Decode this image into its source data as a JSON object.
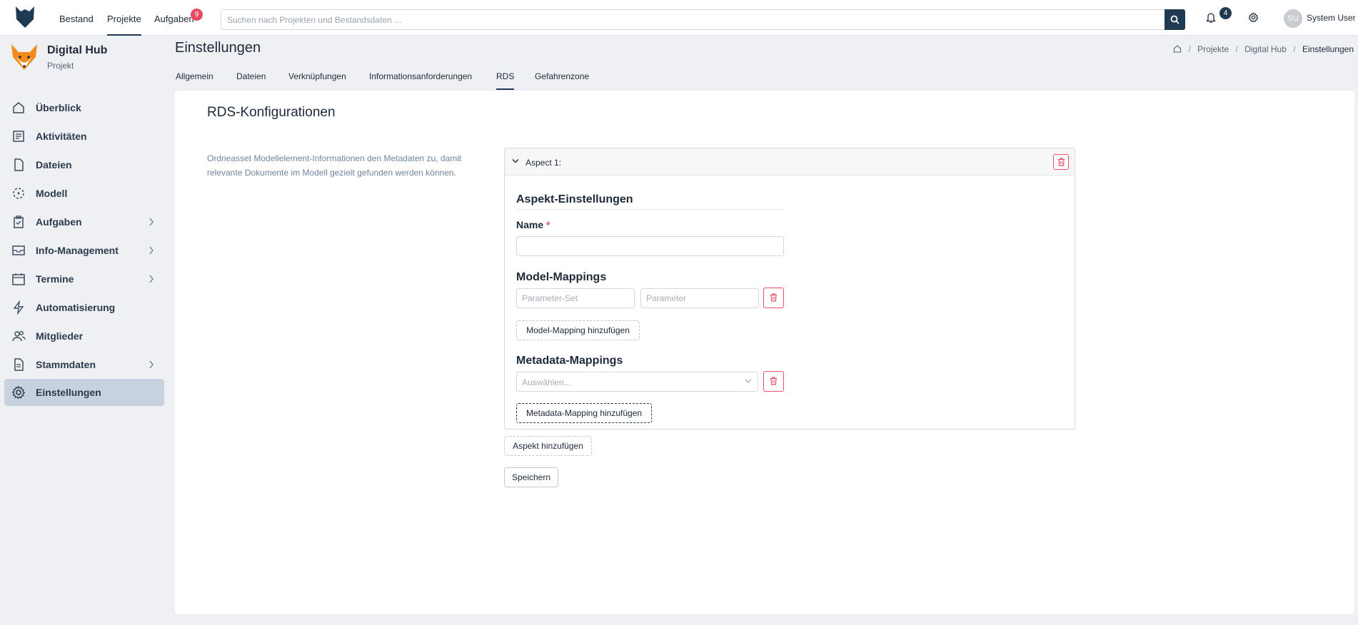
{
  "topbar": {
    "nav": [
      {
        "label": "Bestand"
      },
      {
        "label": "Projekte"
      },
      {
        "label": "Aufgaben"
      }
    ],
    "tasks_badge": "9",
    "search_placeholder": "Suchen nach Projekten und Bestandsdaten ...",
    "notifications_badge": "4",
    "user": {
      "initials": "SU",
      "name": "System User"
    }
  },
  "project": {
    "name": "Digital Hub",
    "subtitle": "Projekt"
  },
  "sidebar": {
    "items": [
      {
        "label": "Überblick",
        "icon": "home-icon"
      },
      {
        "label": "Aktivitäten",
        "icon": "activity-icon"
      },
      {
        "label": "Dateien",
        "icon": "file-icon"
      },
      {
        "label": "Modell",
        "icon": "model-icon"
      },
      {
        "label": "Aufgaben",
        "icon": "tasks-icon"
      },
      {
        "label": "Info-Management",
        "icon": "inbox-icon"
      },
      {
        "label": "Termine",
        "icon": "calendar-icon"
      },
      {
        "label": "Automatisierung",
        "icon": "lightning-icon"
      },
      {
        "label": "Mitglieder",
        "icon": "users-icon"
      },
      {
        "label": "Stammdaten",
        "icon": "document-icon"
      },
      {
        "label": "Einstellungen",
        "icon": "gear-icon"
      }
    ]
  },
  "header": {
    "title": "Einstellungen",
    "breadcrumb": [
      "Projekte",
      "Digital Hub",
      "Einstellungen"
    ]
  },
  "tabs": [
    {
      "label": "Allgemein"
    },
    {
      "label": "Dateien"
    },
    {
      "label": "Verknüpfungen"
    },
    {
      "label": "Informationsanforderungen"
    },
    {
      "label": "RDS"
    },
    {
      "label": "Gefahrenzone"
    }
  ],
  "rds": {
    "title": "RDS-Konfigurationen",
    "description": "Ordneasset Modellelement-Informationen den Metadaten zu, damit relevante Dokumente im Modell gezielt gefunden werden können.",
    "aspect": {
      "header": "Aspect 1:",
      "settings_title": "Aspekt-Einstellungen",
      "name_label": "Name",
      "required_mark": "*",
      "name_value": "",
      "model_mappings_title": "Model-Mappings",
      "parameter_set_placeholder": "Parameter-Set",
      "parameter_placeholder": "Parameter",
      "add_model_mapping": "Model-Mapping hinzufügen",
      "metadata_mappings_title": "Metadata-Mappings",
      "select_placeholder": "Auswählen...",
      "add_metadata_mapping": "Metadata-Mapping hinzufügen"
    },
    "add_aspect": "Aspekt hinzufügen",
    "save": "Speichern"
  },
  "colors": {
    "accent": "#1f3a52",
    "danger": "#e8506a",
    "sidebar_active": "#c8d2de",
    "badge_red": "#e84a62"
  }
}
